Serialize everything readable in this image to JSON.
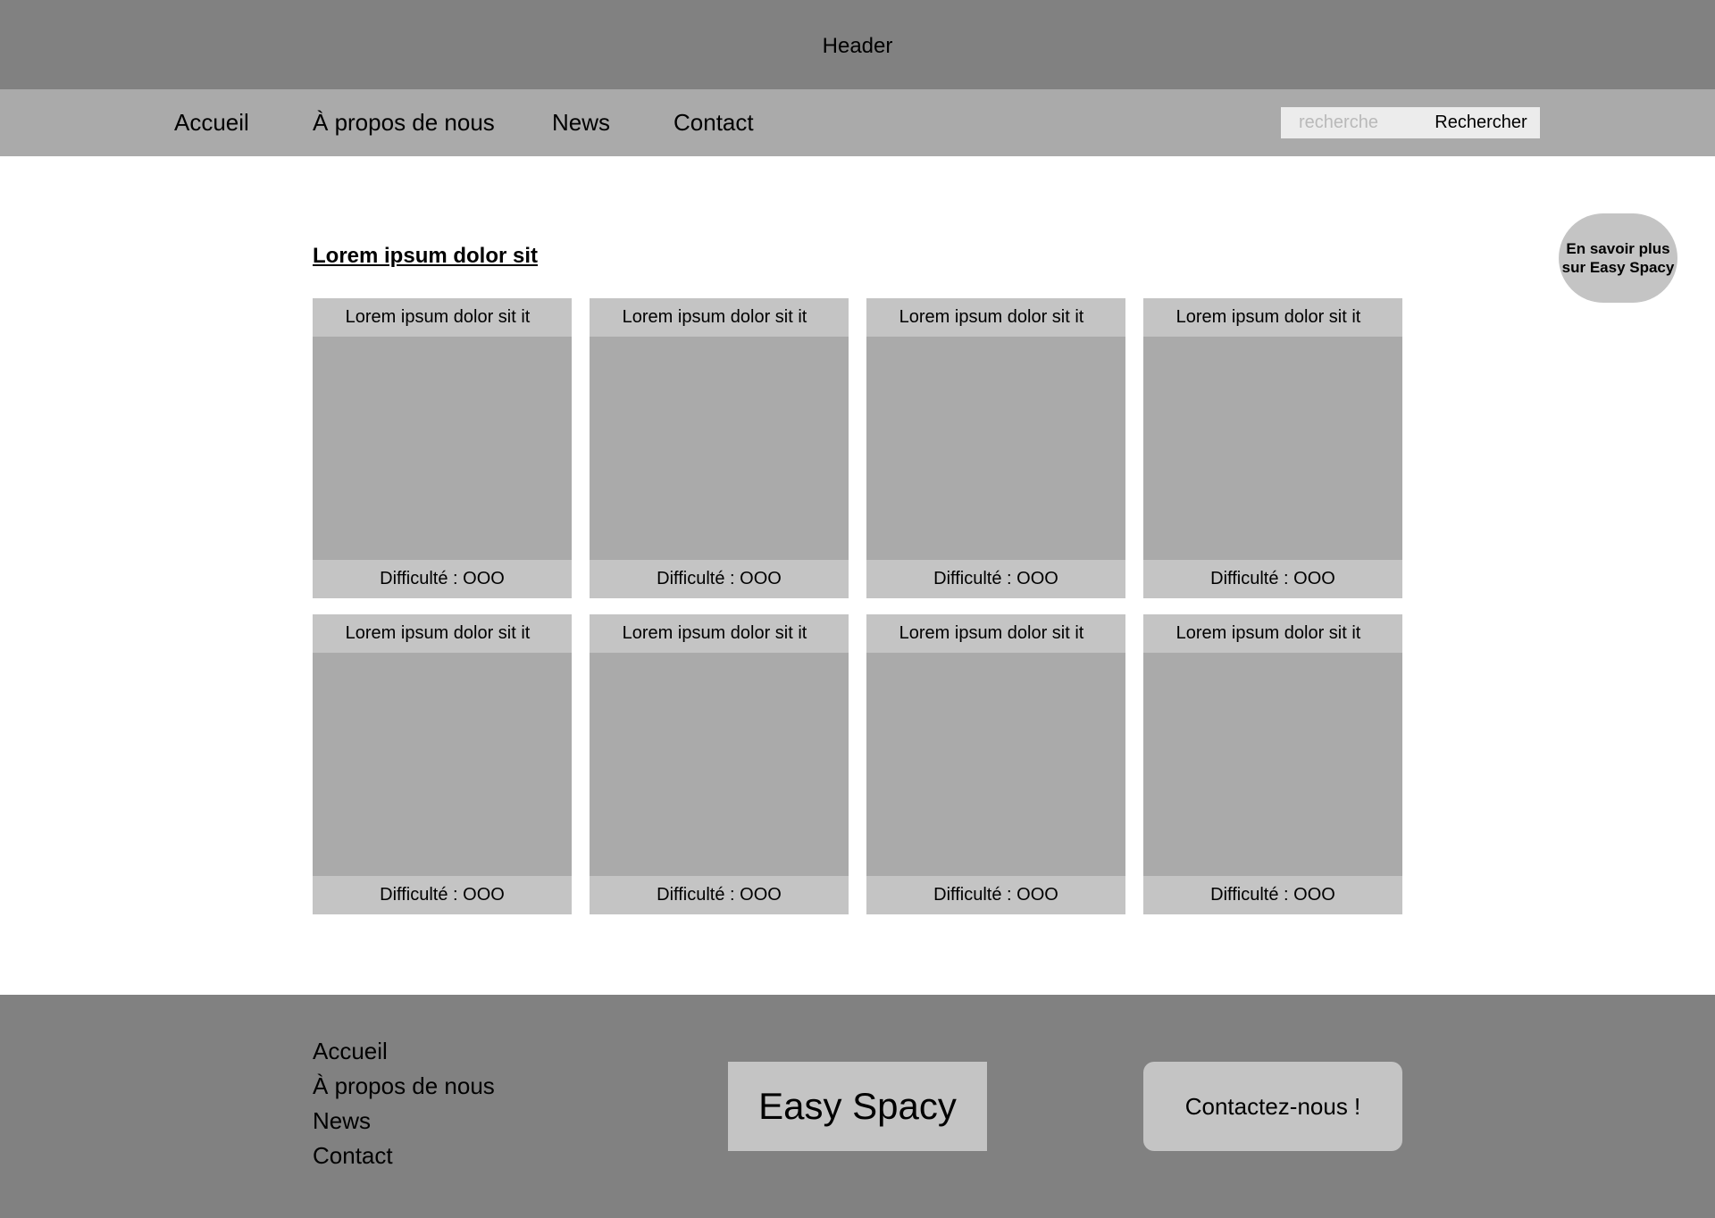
{
  "header": {
    "title": "Header"
  },
  "nav": {
    "items": [
      {
        "label": "Accueil"
      },
      {
        "label": "À propos de nous"
      },
      {
        "label": "News"
      },
      {
        "label": "Contact"
      }
    ],
    "search": {
      "placeholder": "recherche",
      "value": "",
      "button_label": "Rechercher"
    }
  },
  "info_bubble": {
    "line1": "En savoir plus",
    "line2": "sur Easy Spacy"
  },
  "main": {
    "section_title": "Lorem ipsum dolor sit",
    "cards": [
      {
        "title": "Lorem ipsum dolor sit it",
        "difficulty": "Difficulté : OOO"
      },
      {
        "title": "Lorem ipsum dolor sit it",
        "difficulty": "Difficulté : OOO"
      },
      {
        "title": "Lorem ipsum dolor sit it",
        "difficulty": "Difficulté : OOO"
      },
      {
        "title": "Lorem ipsum dolor sit it",
        "difficulty": "Difficulté : OOO"
      },
      {
        "title": "Lorem ipsum dolor sit it",
        "difficulty": "Difficulté : OOO"
      },
      {
        "title": "Lorem ipsum dolor sit it",
        "difficulty": "Difficulté : OOO"
      },
      {
        "title": "Lorem ipsum dolor sit it",
        "difficulty": "Difficulté : OOO"
      },
      {
        "title": "Lorem ipsum dolor sit it",
        "difficulty": "Difficulté : OOO"
      }
    ]
  },
  "footer": {
    "links": [
      {
        "label": "Accueil"
      },
      {
        "label": "À propos de nous"
      },
      {
        "label": "News"
      },
      {
        "label": "Contact"
      }
    ],
    "logo_text": "Easy Spacy",
    "contact_label": "Contactez-nous !"
  },
  "colors": {
    "header_bg": "#818181",
    "nav_bg": "#aaaaaa",
    "card_bar_bg": "#c4c4c4",
    "card_image_bg": "#aaaaaa",
    "search_bg": "#ececec"
  }
}
